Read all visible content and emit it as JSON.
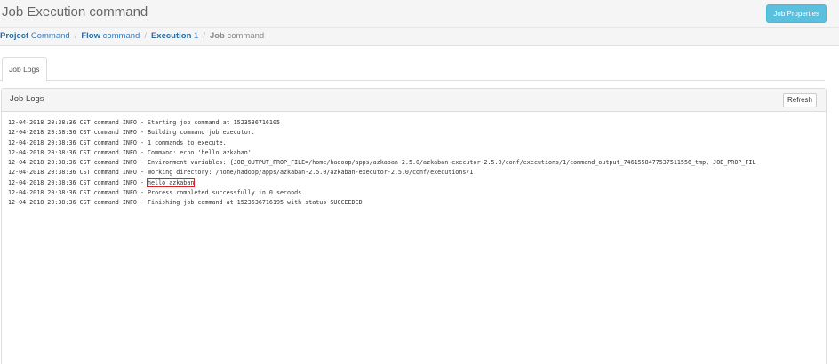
{
  "header": {
    "title": "Job Execution command",
    "button_label": "Job Properties",
    "accent_color": "#5bc0de"
  },
  "breadcrumb": [
    {
      "bold": "Project",
      "rest": " Command",
      "is_link": true
    },
    {
      "bold": "Flow",
      "rest": " command",
      "is_link": true
    },
    {
      "bold": "Execution",
      "rest": " 1",
      "is_link": true
    },
    {
      "bold": "Job",
      "rest": " command",
      "is_link": false
    }
  ],
  "breadcrumb_separator": "/",
  "tabs": [
    {
      "label": "Job Logs",
      "active": true
    }
  ],
  "panel": {
    "title": "Job Logs",
    "refresh_label": "Refresh"
  },
  "log": {
    "lines": [
      {
        "prefix": "12-04-2018 20:38:36 CST command INFO - ",
        "message": "Starting job command at 1523536716105"
      },
      {
        "prefix": "12-04-2018 20:38:36 CST command INFO - ",
        "message": "Building command job executor."
      },
      {
        "prefix": "12-04-2018 20:38:36 CST command INFO - ",
        "message": "1 commands to execute."
      },
      {
        "prefix": "12-04-2018 20:38:36 CST command INFO - ",
        "message": "Command: echo 'hello azkaban'"
      },
      {
        "prefix": "12-04-2018 20:38:36 CST command INFO - ",
        "message": "Environment variables: {JOB_OUTPUT_PROP_FILE=/home/hadoop/apps/azkaban-2.5.0/azkaban-executor-2.5.0/conf/executions/1/command_output_7461558477537511556_tmp, JOB_PROP_FIL"
      },
      {
        "prefix": "12-04-2018 20:38:36 CST command INFO - ",
        "message": "Working directory: /home/hadoop/apps/azkaban-2.5.0/azkaban-executor-2.5.0/conf/executions/1"
      },
      {
        "prefix": "12-04-2018 20:38:36 CST command INFO - ",
        "message": "hello azkaban",
        "highlighted": true
      },
      {
        "prefix": "12-04-2018 20:38:36 CST command INFO - ",
        "message": "Process completed successfully in 0 seconds."
      },
      {
        "prefix": "12-04-2018 20:38:36 CST command INFO - ",
        "message": "Finishing job command at 1523536716195 with status SUCCEEDED"
      }
    ],
    "highlight_color": "#e02020"
  }
}
